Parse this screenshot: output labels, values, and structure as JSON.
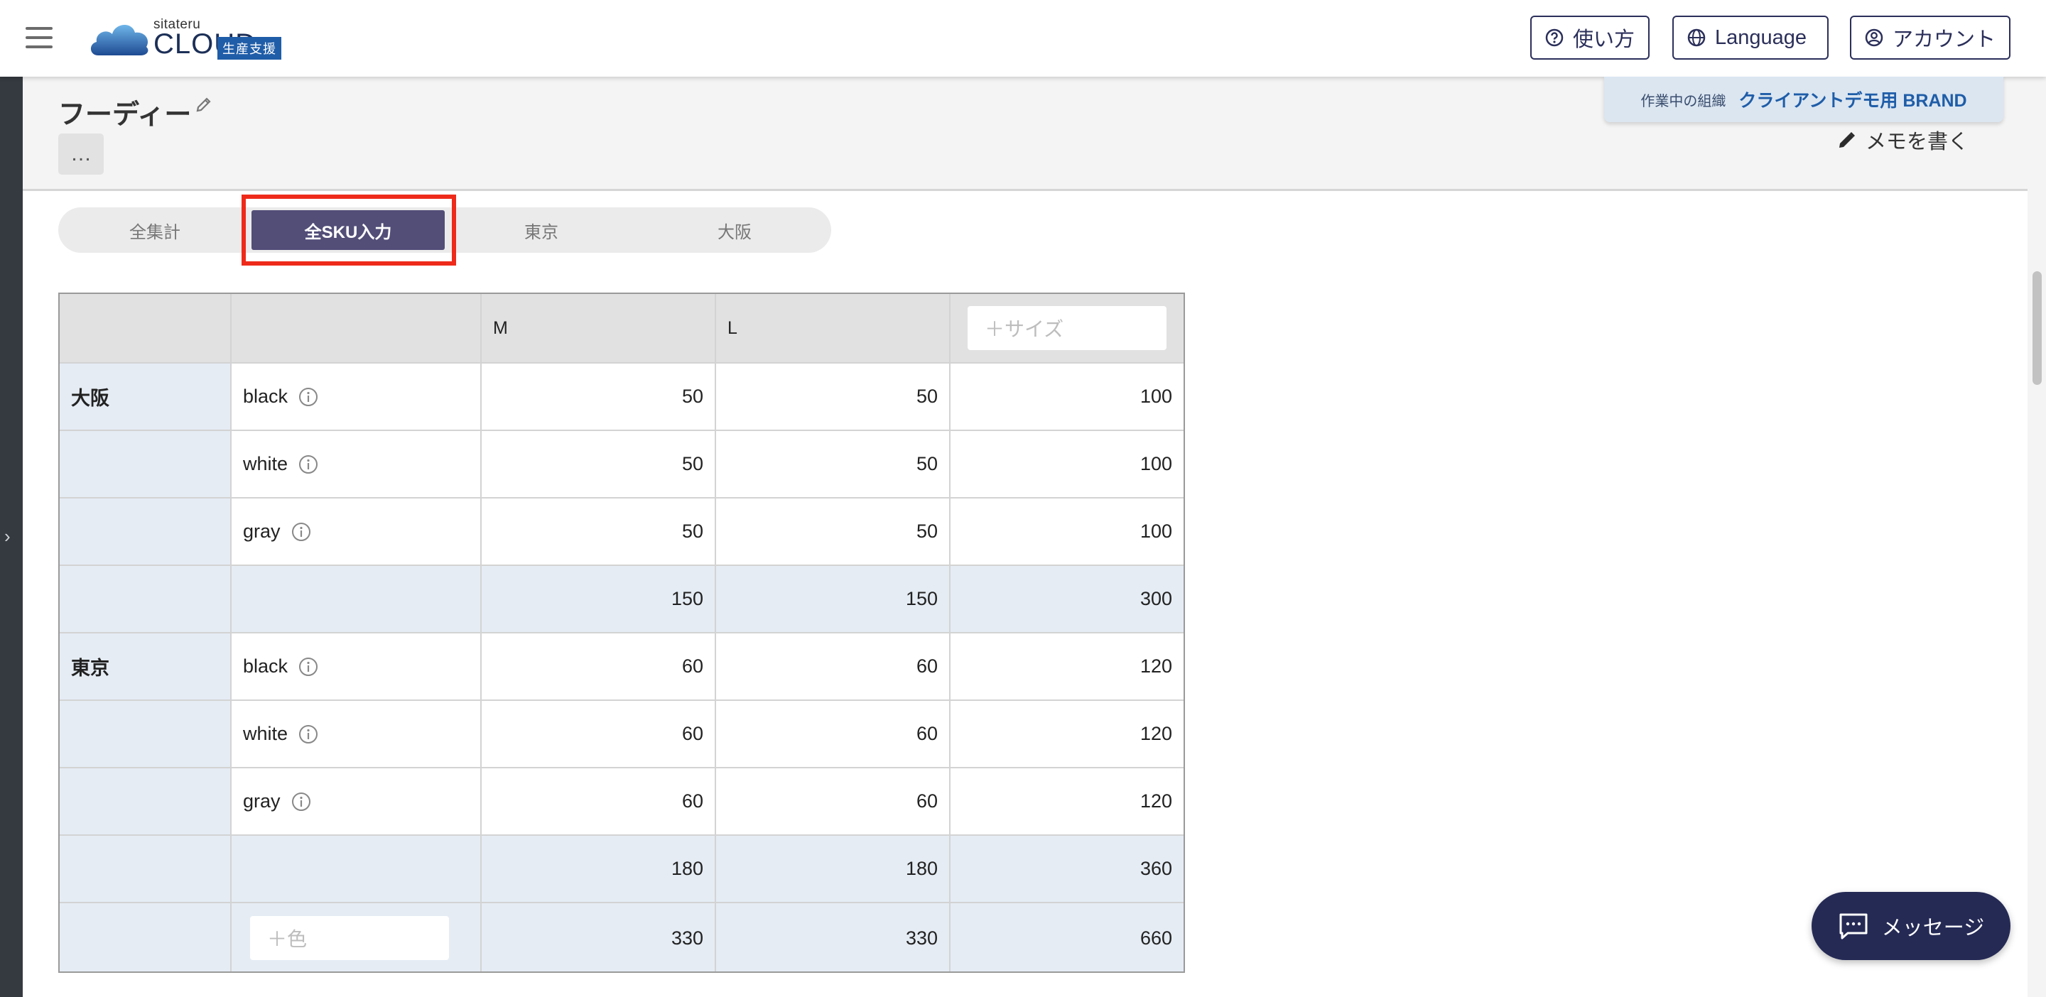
{
  "header": {
    "logo_small": "sitateru",
    "logo_big": "CLOUD",
    "logo_badge": "生産支援",
    "help_label": "使い方",
    "language_label": "Language",
    "account_label": "アカウント"
  },
  "org_banner": {
    "label": "作業中の組織",
    "name": "クライアントデモ用 BRAND"
  },
  "product": {
    "title": "フーディー",
    "more_label": "…",
    "memo_label": "メモを書く"
  },
  "tabs": [
    {
      "label": "全集計",
      "active": false
    },
    {
      "label": "全SKU入力",
      "active": true
    },
    {
      "label": "東京",
      "active": false
    },
    {
      "label": "大阪",
      "active": false
    }
  ],
  "table": {
    "headers": [
      "",
      "",
      "M",
      "L"
    ],
    "add_size_placeholder": "＋サイズ",
    "add_color_placeholder": "＋色",
    "groups": [
      {
        "location": "大阪",
        "rows": [
          {
            "color": "black",
            "values": [
              "50",
              "50",
              "100"
            ]
          },
          {
            "color": "white",
            "values": [
              "50",
              "50",
              "100"
            ]
          },
          {
            "color": "gray",
            "values": [
              "50",
              "50",
              "100"
            ]
          }
        ],
        "subtotal": [
          "150",
          "150",
          "300"
        ]
      },
      {
        "location": "東京",
        "rows": [
          {
            "color": "black",
            "values": [
              "60",
              "60",
              "120"
            ]
          },
          {
            "color": "white",
            "values": [
              "60",
              "60",
              "120"
            ]
          },
          {
            "color": "gray",
            "values": [
              "60",
              "60",
              "120"
            ]
          }
        ],
        "subtotal": [
          "180",
          "180",
          "360"
        ]
      }
    ],
    "grand_total": [
      "330",
      "330",
      "660"
    ]
  },
  "message_button": {
    "label": "メッセージ"
  },
  "colors": {
    "brand_navy": "#252a55",
    "tab_active": "#524e78",
    "highlight_red": "#ee2a1a",
    "badge_blue": "#1f5da8",
    "row_tint": "#e5ecf4"
  },
  "icons": [
    "menu-icon",
    "help-circle-icon",
    "globe-icon",
    "user-circle-icon",
    "pencil-icon",
    "info-icon",
    "chat-icon",
    "chevron-right-icon"
  ]
}
